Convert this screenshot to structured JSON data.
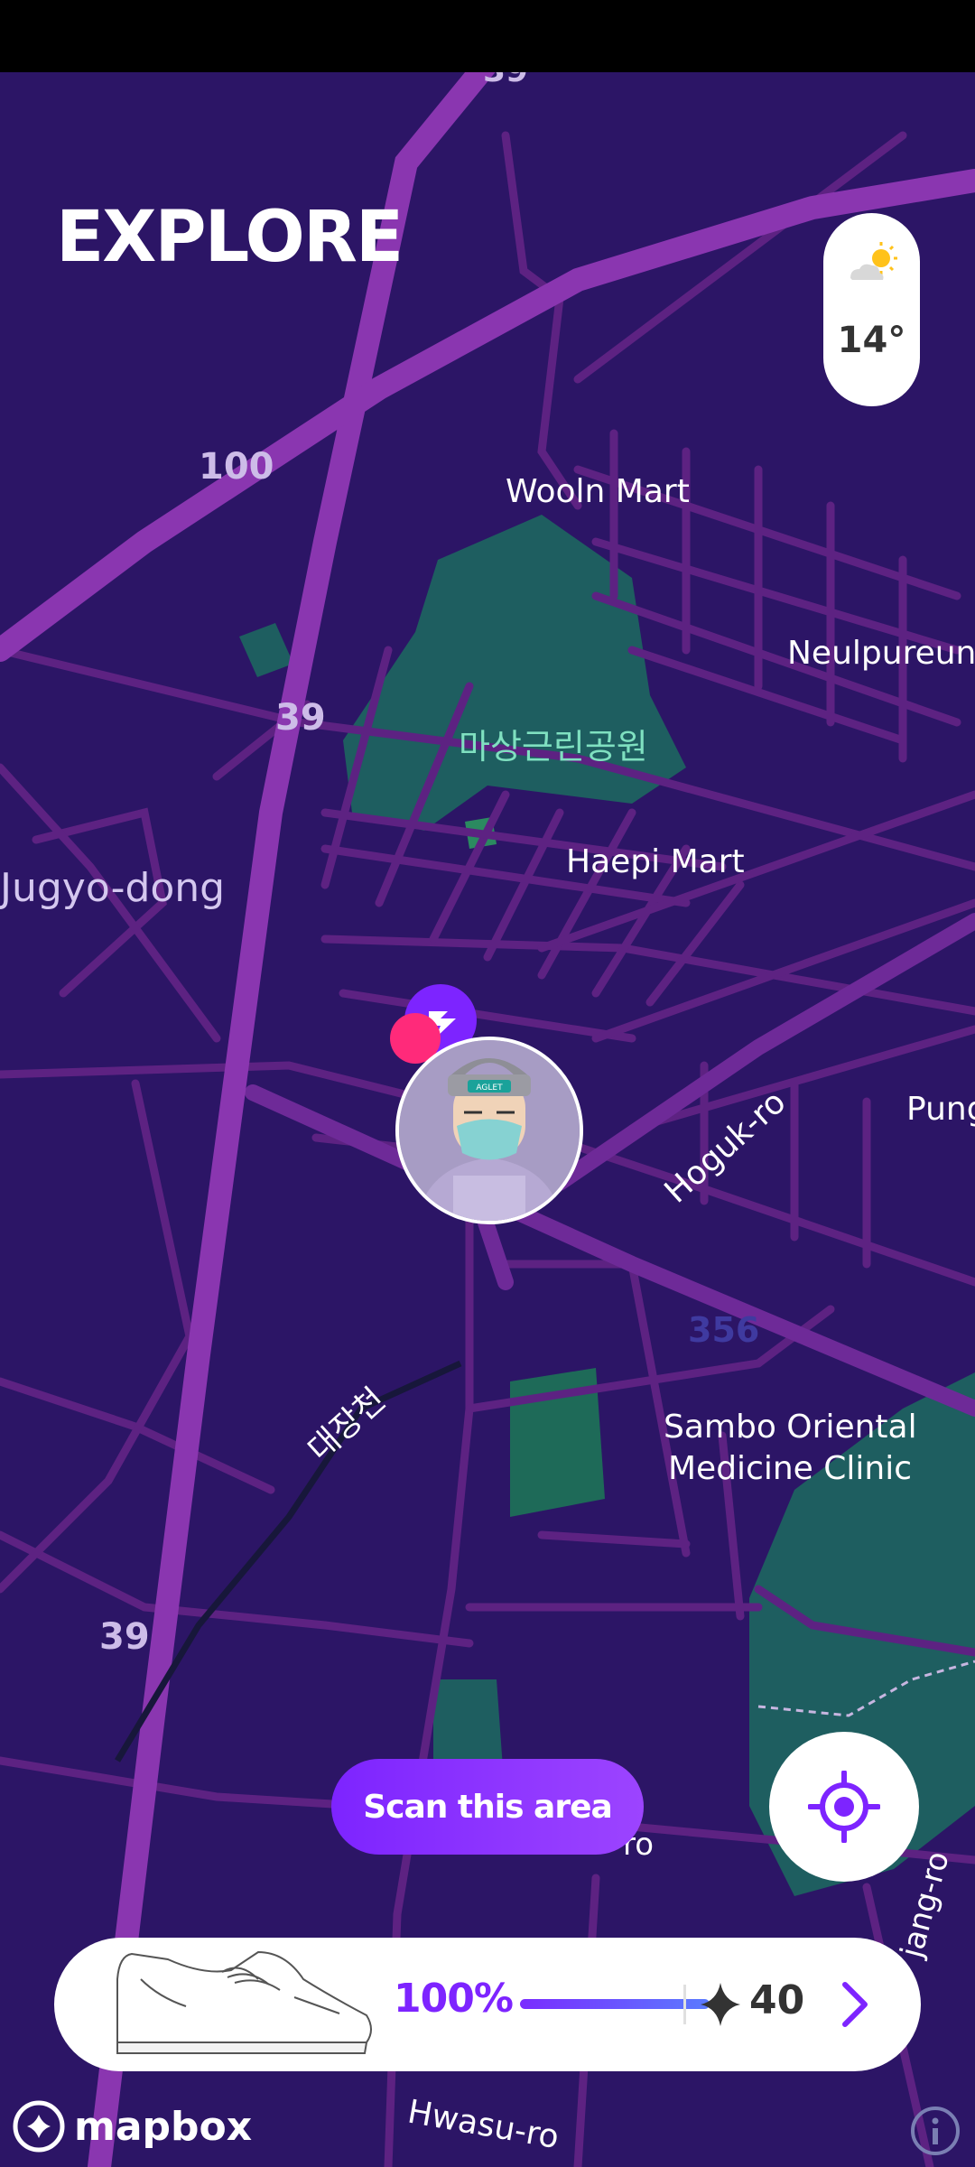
{
  "header": {
    "title": "EXPLORE"
  },
  "weather": {
    "temperature": "14°",
    "icon": "partly-sunny-icon"
  },
  "map": {
    "labels": {
      "road_top": "39",
      "road_100": "100",
      "road_39_mid": "39",
      "road_39_bottom": "39",
      "wooln": "Wooln Mart",
      "neulpureun": "Neulpureun",
      "park": "마상근린공원",
      "jugyo": "Jugyo-dong",
      "haepi": "Haepi Mart",
      "pung": "Pung",
      "hoguk": "Hoguk-ro",
      "road_356": "356",
      "sambo_1": "Sambo Oriental",
      "sambo_2": "Medicine Clinic",
      "stream": "대장천",
      "ro_partial": "ro",
      "jang_ro": "jang-ro",
      "hwasu": "Hwasu-ro",
      "avatar_cap_text": "AGLET"
    }
  },
  "actions": {
    "scan": "Scan this area"
  },
  "bottom_card": {
    "durability": "100%",
    "durability_fraction": 1.0,
    "points": "40"
  },
  "attribution": {
    "logo": "mapbox"
  },
  "colors": {
    "accent": "#7d24ff",
    "map_bg": "#2c1566",
    "road": "#5d2282",
    "highway": "#8a36b0",
    "park": "#1e5e60"
  }
}
